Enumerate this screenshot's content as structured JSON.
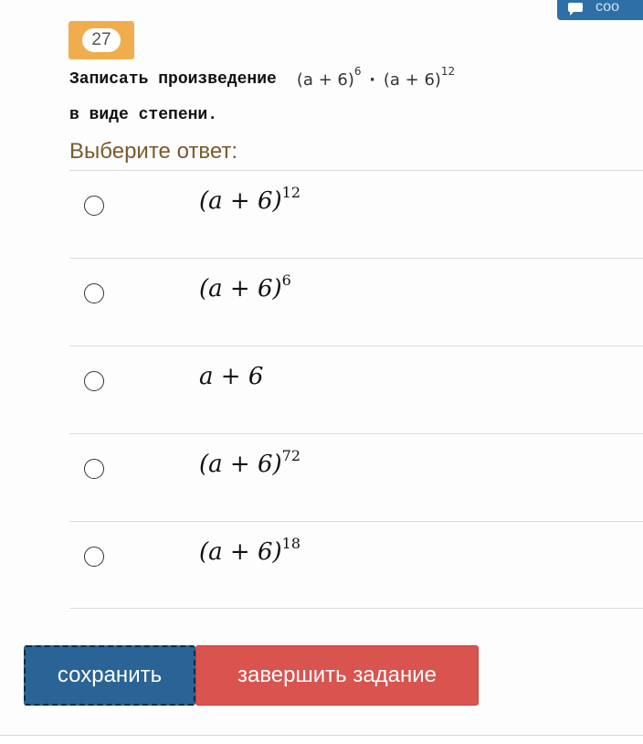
{
  "top_tab": {
    "label": "соо",
    "icon": "comment-icon"
  },
  "question": {
    "number": "27",
    "text_line1": "Записать произведение",
    "expr_base1": "(a + 6)",
    "expr_exp1": "6",
    "expr_dot": "·",
    "expr_base2": "(a + 6)",
    "expr_exp2": "12",
    "text_line2": "в виде степени."
  },
  "prompt": "Выберите ответ:",
  "answers": [
    {
      "base": "(a + 6)",
      "exp": "12"
    },
    {
      "base": "(a + 6)",
      "exp": "6"
    },
    {
      "base": "a + 6",
      "exp": ""
    },
    {
      "base": "(a + 6)",
      "exp": "72"
    },
    {
      "base": "(a + 6)",
      "exp": "18"
    }
  ],
  "buttons": {
    "save_label": "сохранить",
    "finish_label": "завершить задание"
  },
  "colors": {
    "badge": "#f0ad4e",
    "save": "#2a6496",
    "finish": "#d9534f",
    "prompt": "#7a5a2b"
  }
}
